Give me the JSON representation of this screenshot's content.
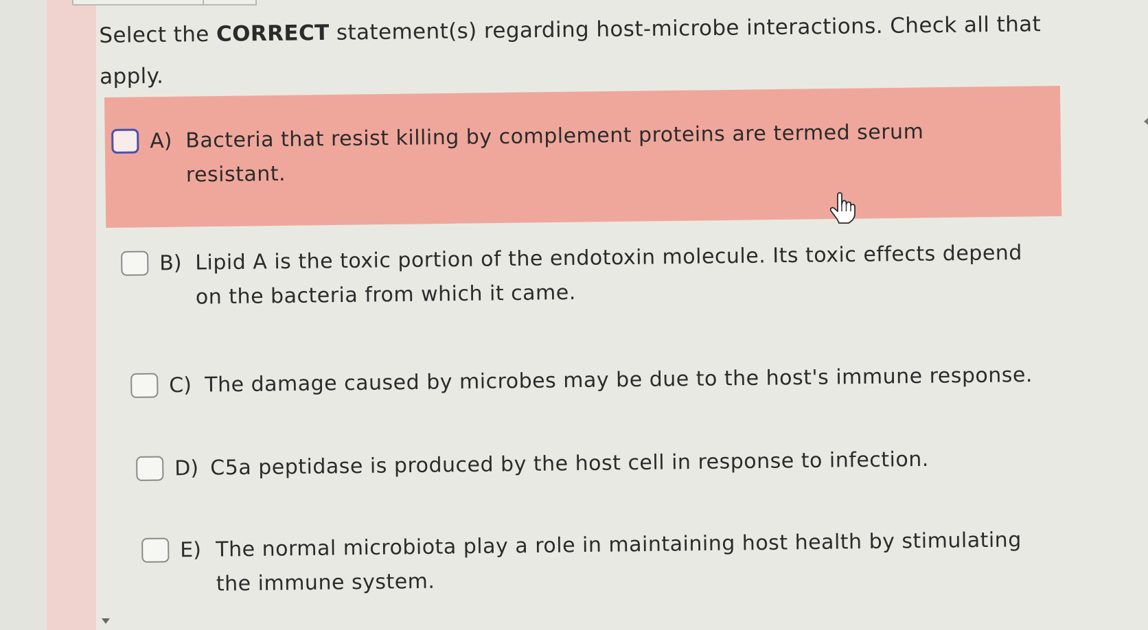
{
  "question": {
    "prefix": "Select the ",
    "emphasis": "CORRECT",
    "suffix_line1": " statement(s) regarding host-microbe interactions.  Check all that",
    "suffix_line2": "apply."
  },
  "options": [
    {
      "letter": "A)",
      "line1": "Bacteria that resist killing by complement proteins are termed serum",
      "line2": "resistant.",
      "checked": false,
      "hovered": true
    },
    {
      "letter": "B)",
      "line1": "Lipid A is the toxic portion of the endotoxin molecule.  Its toxic effects depend",
      "line2": "on the bacteria from which it came.",
      "checked": false,
      "hovered": false
    },
    {
      "letter": "C)",
      "line1": "The damage caused by microbes may be due to the host's immune response.",
      "line2": "",
      "checked": false,
      "hovered": false
    },
    {
      "letter": "D)",
      "line1": "C5a peptidase is produced by the host cell in response to infection.",
      "line2": "",
      "checked": false,
      "hovered": false
    },
    {
      "letter": "E)",
      "line1": "The normal microbiota play a role in maintaining host health by stimulating",
      "line2": "the immune system.",
      "checked": false,
      "hovered": false
    }
  ],
  "icons": {
    "cursor": "hand-pointer-icon",
    "scroll": "scroll-down-arrow-icon"
  },
  "colors": {
    "highlight": "#efa79c",
    "sidebar": "#f0d3cf",
    "active_checkbox_border": "#4c4fae",
    "background": "#e9e9e3"
  }
}
